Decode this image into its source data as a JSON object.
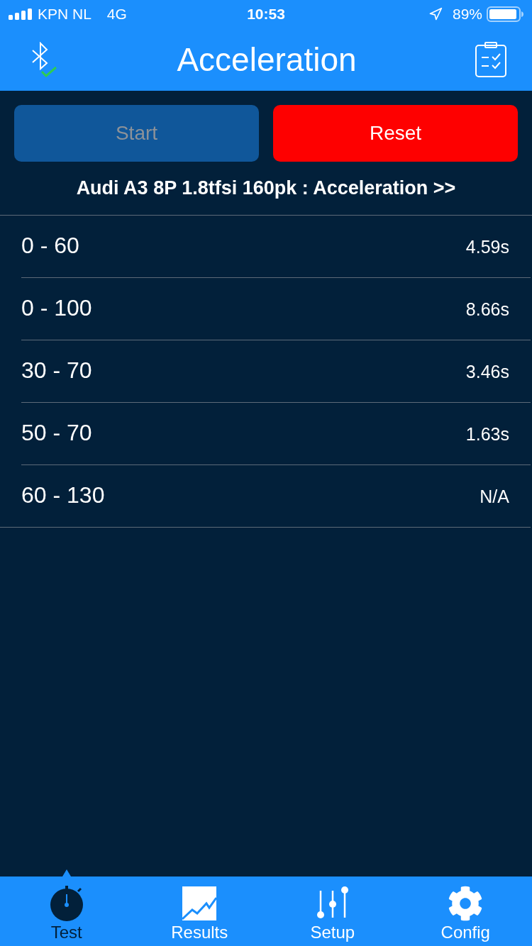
{
  "status_bar": {
    "carrier": "KPN NL",
    "network": "4G",
    "time": "10:53",
    "battery": "89%"
  },
  "nav_bar": {
    "title": "Acceleration"
  },
  "buttons": [
    {
      "label": "Start",
      "kind": "primary",
      "disabled": true
    },
    {
      "label": "Reset",
      "kind": "destructive",
      "disabled": false
    }
  ],
  "profile_link": "Audi A3 8P 1.8tfsi 160pk : Acceleration >>",
  "results": [
    {
      "range": "0 - 60",
      "time": "4.59s"
    },
    {
      "range": "0 - 100",
      "time": "8.66s"
    },
    {
      "range": "30 - 70",
      "time": "3.46s"
    },
    {
      "range": "50 - 70",
      "time": "1.63s"
    },
    {
      "range": "60 - 130",
      "time": "N/A"
    }
  ],
  "tabs": [
    {
      "label": "Test",
      "selected": true
    },
    {
      "label": "Results",
      "selected": false
    },
    {
      "label": "Setup",
      "selected": false
    },
    {
      "label": "Config",
      "selected": false
    }
  ]
}
